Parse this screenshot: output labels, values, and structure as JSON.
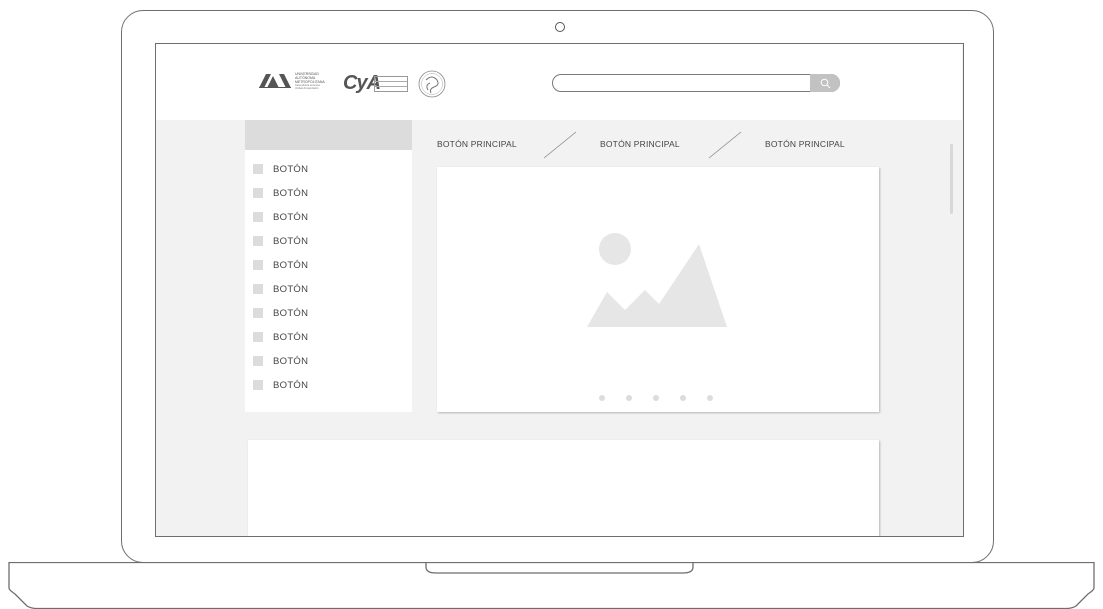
{
  "header": {
    "logos": [
      {
        "name": "uam-logo",
        "lines": [
          "UNIVERSIDAD",
          "AUTÓNOMA",
          "METROPOLITANA"
        ],
        "sub": [
          "Casa abierta al tiempo",
          "Unidad Azcapotzalco"
        ]
      },
      {
        "name": "cya-logo",
        "text": "CyA"
      },
      {
        "name": "seal-logo",
        "icon": "circular-seal-icon"
      }
    ],
    "search": {
      "value": "",
      "placeholder": "",
      "icon": "search-icon"
    }
  },
  "sidebar": {
    "items": [
      {
        "label": "BOTÓN"
      },
      {
        "label": "BOTÓN"
      },
      {
        "label": "BOTÓN"
      },
      {
        "label": "BOTÓN"
      },
      {
        "label": "BOTÓN"
      },
      {
        "label": "BOTÓN"
      },
      {
        "label": "BOTÓN"
      },
      {
        "label": "BOTÓN"
      },
      {
        "label": "BOTÓN"
      },
      {
        "label": "BOTÓN"
      }
    ]
  },
  "nav": {
    "items": [
      {
        "label": "BOTÓN PRINCIPAL"
      },
      {
        "label": "BOTÓN PRINCIPAL"
      },
      {
        "label": "BOTÓN PRINCIPAL"
      }
    ]
  },
  "carousel": {
    "image_icon": "image-placeholder-icon",
    "slide_count": 5
  },
  "colors": {
    "frame": "#6e6e6e",
    "screen_bg": "#f2f2f2",
    "placeholder": "#dcdcdc",
    "text": "#444444"
  }
}
